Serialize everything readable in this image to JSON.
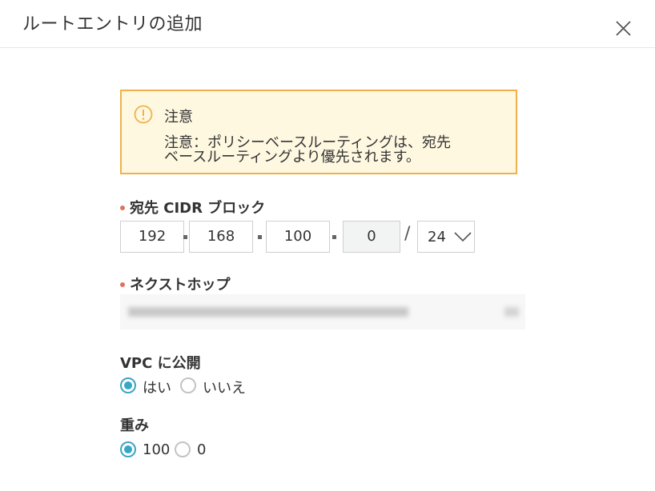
{
  "dialog": {
    "title": "ルートエントリの追加"
  },
  "notice": {
    "heading": "注意",
    "line1": "注意：ポリシーベースルーティングは、宛先",
    "line2": "ベースルーティングより優先されます。"
  },
  "destination_cidr": {
    "label": "宛先 CIDR ブロック",
    "octets": [
      "192",
      "168",
      "100",
      "0"
    ],
    "prefix_separator": "/",
    "prefix": "24"
  },
  "next_hop": {
    "label": "ネクストホップ"
  },
  "publish_to_vpc": {
    "label": "VPC に公開",
    "options": [
      "はい",
      "いいえ"
    ],
    "selected": "はい"
  },
  "weight": {
    "label": "重み",
    "options": [
      "100",
      "0"
    ],
    "selected": "100"
  },
  "colors": {
    "accent": "#39a6c6",
    "warning_border": "#f0b14b",
    "warning_bg": "#fff8e1",
    "required": "#e0735e"
  }
}
